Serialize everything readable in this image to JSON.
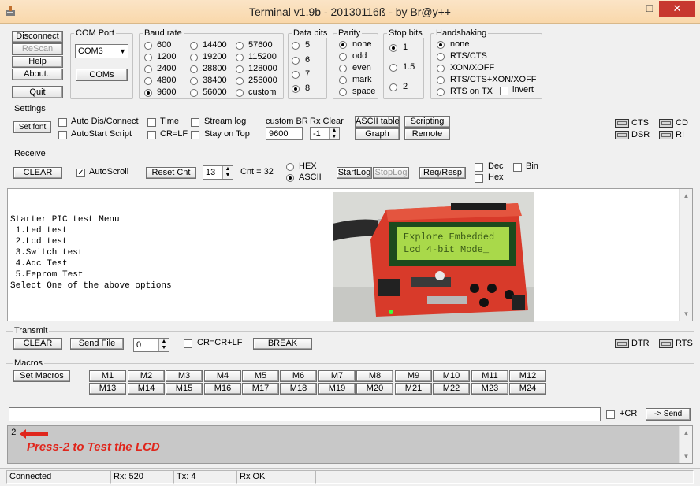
{
  "window": {
    "title": "Terminal v1.9b - 20130116ß - by Br@y++",
    "minimize": "–",
    "maximize": "□",
    "close": "✕"
  },
  "left_buttons": {
    "disconnect": "Disconnect",
    "rescan": "ReScan",
    "help": "Help",
    "about": "About..",
    "quit": "Quit"
  },
  "com_port": {
    "group_title": "COM Port",
    "selected": "COM3",
    "coms_button": "COMs"
  },
  "baud_rate": {
    "group_title": "Baud rate",
    "options": [
      "600",
      "1200",
      "2400",
      "4800",
      "9600",
      "14400",
      "19200",
      "28800",
      "38400",
      "56000",
      "57600",
      "115200",
      "128000",
      "256000",
      "custom"
    ],
    "selected": "9600"
  },
  "data_bits": {
    "group_title": "Data bits",
    "options": [
      "5",
      "6",
      "7",
      "8"
    ],
    "selected": "8"
  },
  "parity": {
    "group_title": "Parity",
    "options": [
      "none",
      "odd",
      "even",
      "mark",
      "space"
    ],
    "selected": "none"
  },
  "stop_bits": {
    "group_title": "Stop bits",
    "options": [
      "1",
      "1.5",
      "2"
    ],
    "selected": "1"
  },
  "handshaking": {
    "group_title": "Handshaking",
    "options": [
      "none",
      "RTS/CTS",
      "XON/XOFF",
      "RTS/CTS+XON/XOFF",
      "RTS on TX"
    ],
    "selected": "none",
    "invert_label": "invert"
  },
  "settings": {
    "group_title": "Settings",
    "set_font": "Set font",
    "auto_dis_connect": "Auto Dis/Connect",
    "autostart_script": "AutoStart Script",
    "time": "Time",
    "cr_lf": "CR=LF",
    "stream_log": "Stream log",
    "stay_on_top": "Stay on Top",
    "custom_br_label": "custom BR",
    "custom_br_value": "9600",
    "rx_clear_label": "Rx Clear",
    "rx_clear_value": "-1",
    "ascii_table": "ASCII table",
    "graph": "Graph",
    "scripting": "Scripting",
    "remote": "Remote",
    "cts": "CTS",
    "dsr": "DSR",
    "cd": "CD",
    "ri": "RI"
  },
  "receive": {
    "group_title": "Receive",
    "clear": "CLEAR",
    "autoscroll": "AutoScroll",
    "reset_cnt": "Reset Cnt",
    "cnt_box": "13",
    "cnt_text": "Cnt =  32",
    "hex": "HEX",
    "ascii": "ASCII",
    "start_log": "StartLog",
    "stop_log": "StopLog",
    "req_resp": "Req/Resp",
    "dec": "Dec",
    "hex_check": "Hex",
    "bin": "Bin",
    "lines": [
      "Starter PIC test Menu",
      " 1.Led test",
      " 2.Lcd test",
      " 3.Switch test",
      " 4.Adc Test",
      " 5.Eeprom Test",
      "Select One of the above options"
    ]
  },
  "photo": {
    "lcd_line1": "Explore Embedded",
    "lcd_line2": "Lcd 4-bit Mode_"
  },
  "transmit": {
    "group_title": "Transmit",
    "clear": "CLEAR",
    "send_file": "Send File",
    "spin_value": "0",
    "cr_crlf": "CR=CR+LF",
    "break": "BREAK",
    "dtr": "DTR",
    "rts": "RTS"
  },
  "macros": {
    "group_title": "Macros",
    "set_macros": "Set Macros",
    "row1": [
      "M1",
      "M2",
      "M3",
      "M4",
      "M5",
      "M6",
      "M7",
      "M8",
      "M9",
      "M10",
      "M11",
      "M12"
    ],
    "row2": [
      "M13",
      "M14",
      "M15",
      "M16",
      "M17",
      "M18",
      "M19",
      "M20",
      "M21",
      "M22",
      "M23",
      "M24"
    ]
  },
  "send": {
    "input_value": "",
    "plus_cr": "+CR",
    "send_button": "-> Send"
  },
  "send_log": {
    "typed": "2",
    "annotation": "Press-2 to Test the LCD"
  },
  "status": {
    "connection": "Connected",
    "rx": "Rx: 520",
    "tx": "Tx: 4",
    "rx_state": "Rx OK"
  },
  "colors": {
    "annotation": "#e0261c",
    "pcb": "#d83a2a",
    "lcd": "#a9d94a",
    "titlebar": "#f9d8ab"
  }
}
